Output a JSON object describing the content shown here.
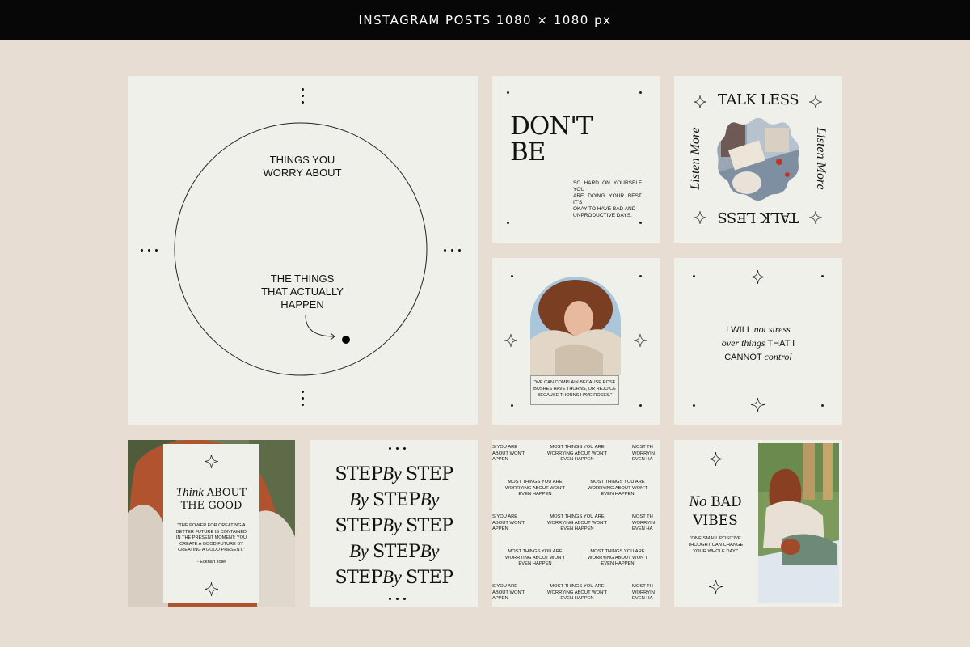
{
  "header": {
    "title": "INSTAGRAM POSTS 1080 × 1080 px"
  },
  "colors": {
    "background": "#e8ddd3",
    "tile": "#f0f0ea",
    "bar": "#070707",
    "ink": "#111111"
  },
  "tile_circle": {
    "top_text_1": "THINGS YOU",
    "top_text_2": "WORRY ABOUT",
    "bottom_text_1": "THE THINGS",
    "bottom_text_2": "THAT ACTUALLY",
    "bottom_text_3": "HAPPEN",
    "icons": [
      "dots-vertical-icon",
      "dots-horizontal-icon",
      "curved-arrow-icon",
      "filled-dot-icon"
    ]
  },
  "tile_dont_be": {
    "title_1": "DON'T",
    "title_2": "BE",
    "body_1": "SO HARD ON YOURSELF. YOU",
    "body_2": "ARE DOING YOUR BEST. IT'S",
    "body_3": "OKAY TO HAVE BAD AND",
    "body_4": "UNPRODUCTIVE DAYS."
  },
  "tile_talk_less": {
    "top": "TALK LESS",
    "bottom": "TALK LESS",
    "left": "Listen More",
    "right": "Listen More",
    "icons": [
      "sparkle-icon",
      "photo-reading-book"
    ]
  },
  "tile_rose": {
    "quote_1": "\"WE CAN COMPLAIN BECAUSE ROSE",
    "quote_2": "BUSHES HAVE THORNS, OR REJOICE",
    "quote_3": "BECAUSE THORNS HAVE ROSES.\""
  },
  "tile_stress": {
    "l1_a": "I WILL ",
    "l1_b": "not stress",
    "l2_a": "over things ",
    "l2_b": "THAT I",
    "l3_a": "CANNOT ",
    "l3_b": "control"
  },
  "tile_good": {
    "title_1a": "Think ",
    "title_1b": "ABOUT",
    "title_2": "THE GOOD",
    "quote_1": "\"THE POWER FOR CREATING A",
    "quote_2": "BETTER FUTURE IS CONTAINED",
    "quote_3": "IN THE PRESENT MOMENT: YOU",
    "quote_4": "CREATE A GOOD FUTURE BY",
    "quote_5": "CREATING A GOOD PRESENT.\"",
    "author": "- Eckhart Tolle"
  },
  "tile_step": {
    "w_step": "STEP",
    "w_by": "By"
  },
  "tile_worry_pattern": {
    "full_1": "MOST THINGS YOU ARE",
    "full_2": "WORRYING ABOUT WON'T",
    "full_3": "EVEN HAPPEN",
    "left_1": "S YOU ARE",
    "left_2": "ABOUT WON'T",
    "left_3": "APPEN",
    "right_1": "MOST TH",
    "right_2": "WORRYIN",
    "right_3": "EVEN HA"
  },
  "tile_vibes": {
    "title_1a": "No ",
    "title_1b": "BAD",
    "title_2": "VIBES",
    "quote_1": "\"ONE SMALL POSITIVE",
    "quote_2": "THOUGHT CAN CHANGE",
    "quote_3": "YOUR WHOLE DAY.\""
  }
}
